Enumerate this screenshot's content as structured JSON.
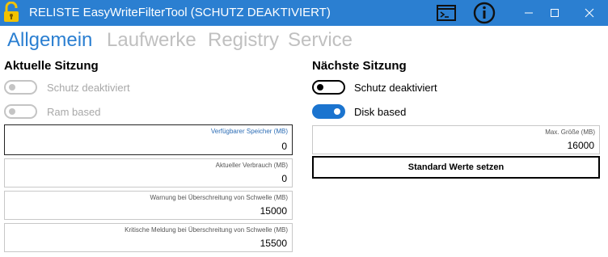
{
  "window": {
    "title": "RELISTE EasyWriteFilterTool (SCHUTZ DEAKTIVIERT)",
    "icons": {
      "app": "unlocked-padlock-icon",
      "console": "console-icon",
      "info": "info-icon",
      "minimize": "minimize-icon",
      "maximize": "maximize-icon",
      "close": "close-icon"
    }
  },
  "tabs": [
    {
      "label": "Allgemein",
      "active": true
    },
    {
      "label": "Laufwerke",
      "active": false
    },
    {
      "label": "Registry",
      "active": false
    },
    {
      "label": "Service",
      "active": false
    }
  ],
  "current_session": {
    "title": "Aktuelle Sitzung",
    "toggles": [
      {
        "label": "Schutz deaktiviert",
        "on": false,
        "enabled": false
      },
      {
        "label": "Ram based",
        "on": false,
        "enabled": false
      }
    ],
    "fields": [
      {
        "label": "Verfügbarer Speicher (MB)",
        "value": "0"
      },
      {
        "label": "Aktueller Verbrauch (MB)",
        "value": "0"
      },
      {
        "label": "Warnung bei Überschreitung von Schwelle (MB)",
        "value": "15000"
      },
      {
        "label": "Kritische Meldung bei Überschreitung von Schwelle (MB)",
        "value": "15500"
      }
    ]
  },
  "next_session": {
    "title": "Nächste Sitzung",
    "toggles": [
      {
        "label": "Schutz deaktiviert",
        "on": false,
        "enabled": true
      },
      {
        "label": "Disk based",
        "on": true,
        "enabled": true
      }
    ],
    "fields": [
      {
        "label": "Max. Größe (MB)",
        "value": "16000"
      }
    ],
    "button_label": "Standard Werte setzen"
  },
  "colors": {
    "accent": "#2b7fd1",
    "toggle_on": "#1b74cf",
    "muted_text": "#a8a8a8"
  }
}
